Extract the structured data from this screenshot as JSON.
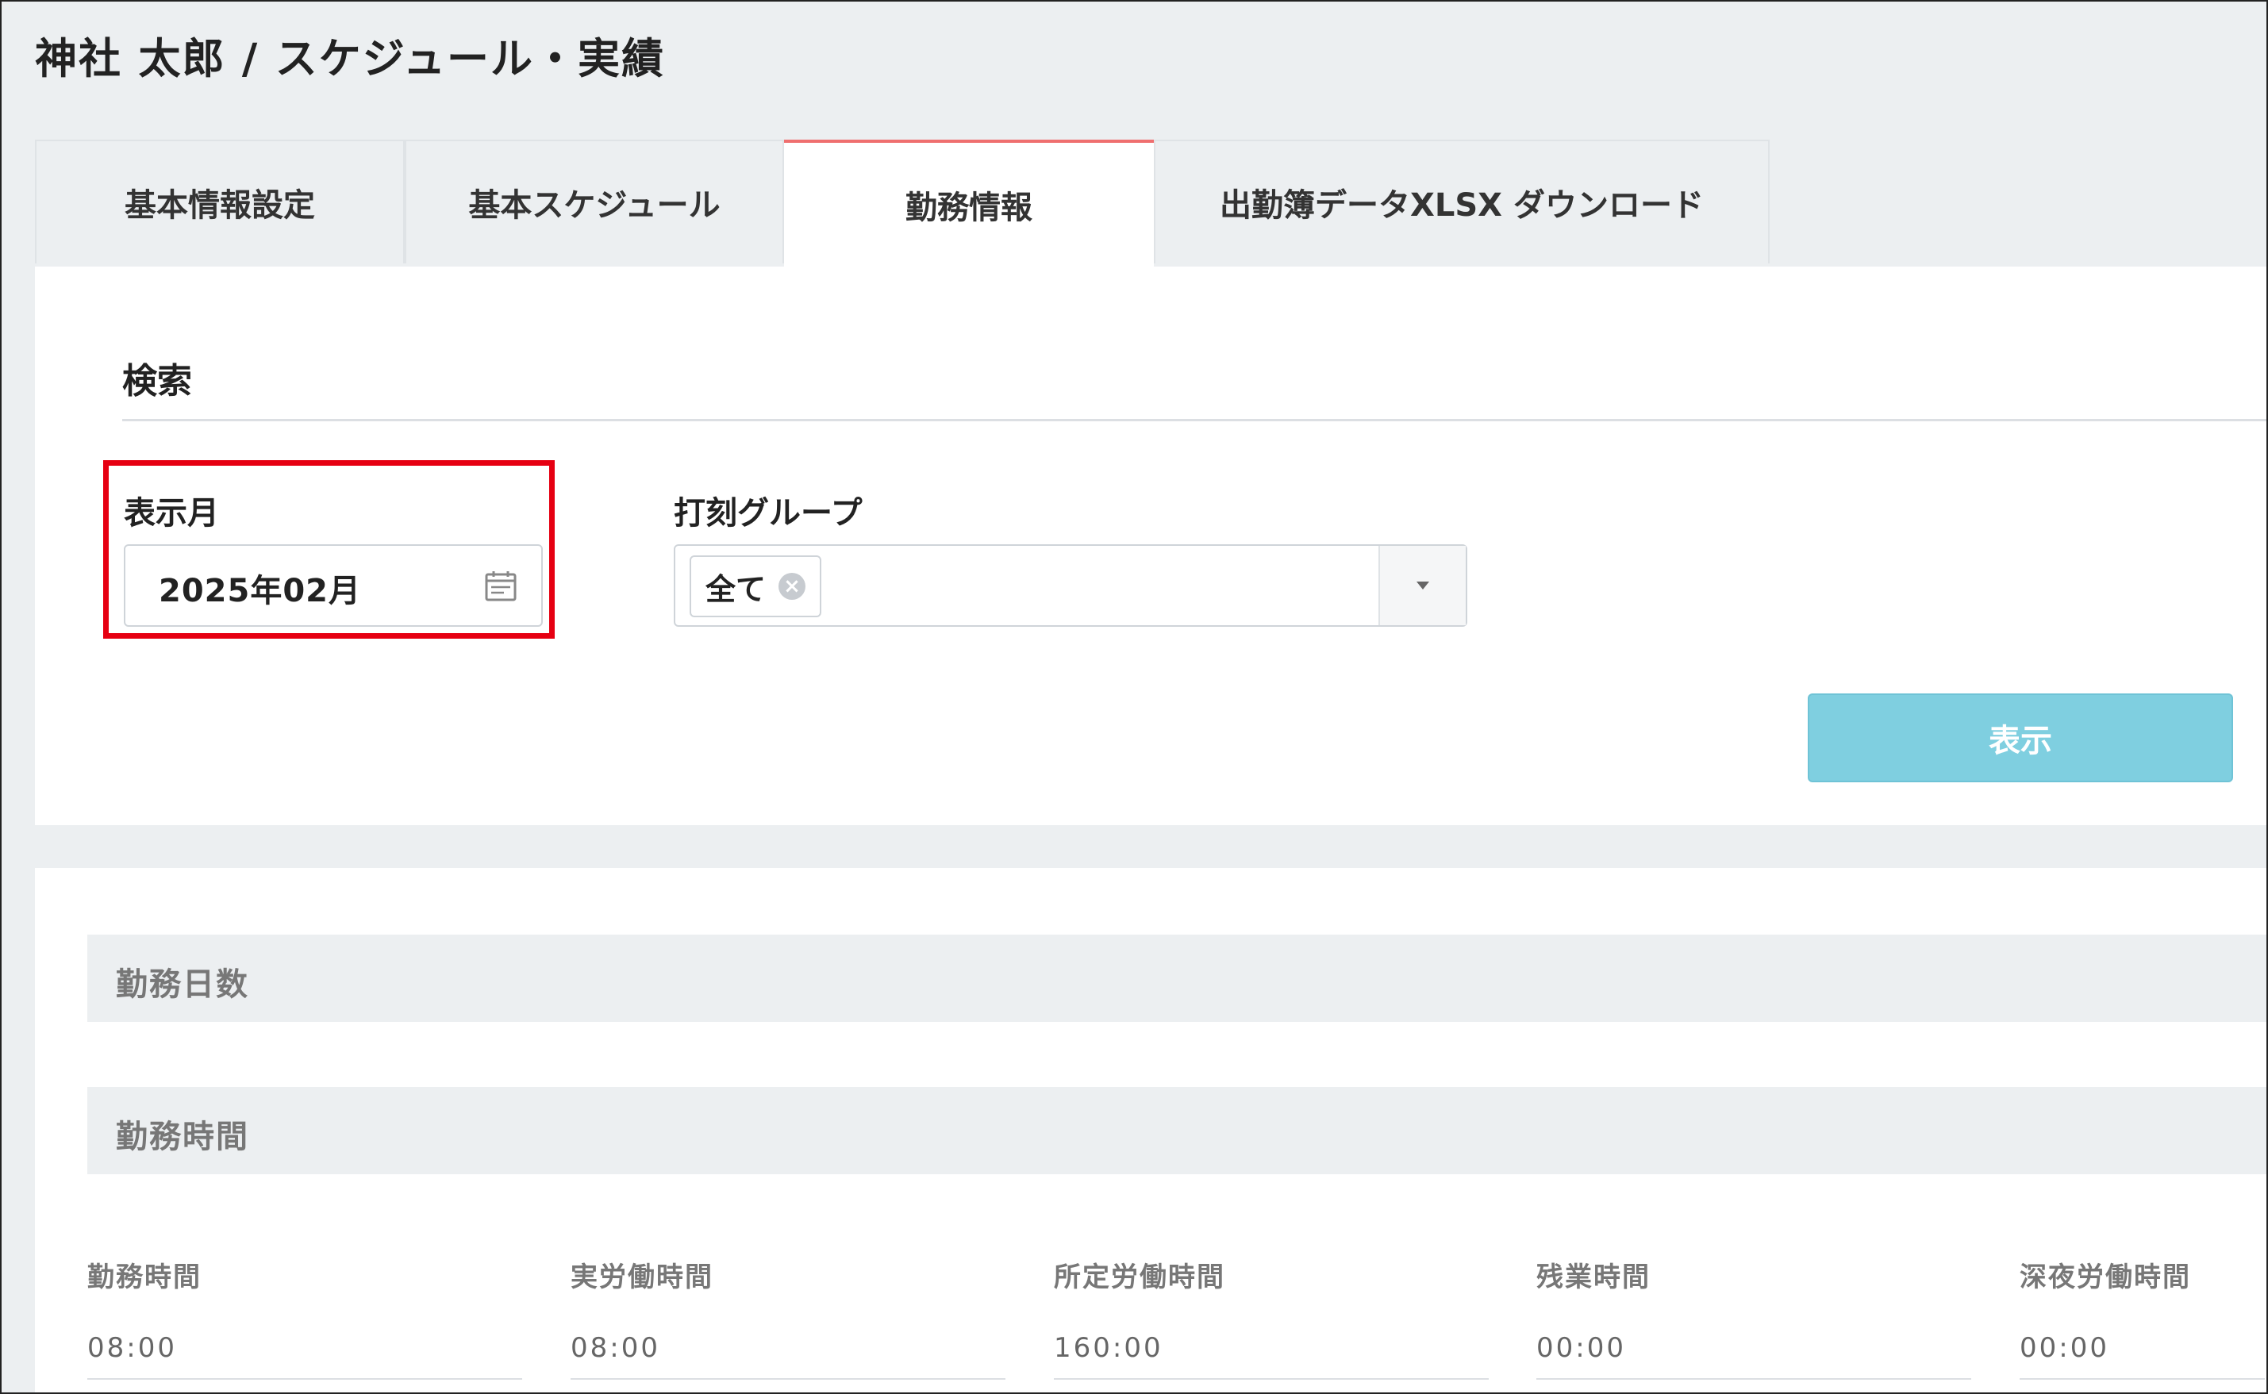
{
  "header": {
    "title": "神社 太郎 / スケジュール・実績"
  },
  "tabs": [
    {
      "label": "基本情報設定",
      "active": false
    },
    {
      "label": "基本スケジュール",
      "active": false
    },
    {
      "label": "勤務情報",
      "active": true
    },
    {
      "label": "出勤簿データXLSX ダウンロード",
      "active": false
    }
  ],
  "search": {
    "title": "検索",
    "month": {
      "label": "表示月",
      "value": "2025年02月",
      "icon": "calendar-icon"
    },
    "group": {
      "label": "打刻グループ",
      "chip": "全て",
      "remove_icon": "clear-icon",
      "dropdown_icon": "caret-down-icon"
    },
    "submit_label": "表示"
  },
  "summary": {
    "work_days_header": "勤務日数",
    "work_time_header": "勤務時間",
    "stats": [
      {
        "label": "勤務時間",
        "value": "08:00"
      },
      {
        "label": "実労働時間",
        "value": "08:00"
      },
      {
        "label": "所定労働時間",
        "value": "160:00"
      },
      {
        "label": "残業時間",
        "value": "00:00"
      },
      {
        "label": "深夜労働時間",
        "value": "00:00"
      }
    ]
  },
  "colors": {
    "active_tab_accent": "#ef6f6f",
    "highlight_border": "#e60012",
    "primary_button": "#7fcfe0"
  }
}
